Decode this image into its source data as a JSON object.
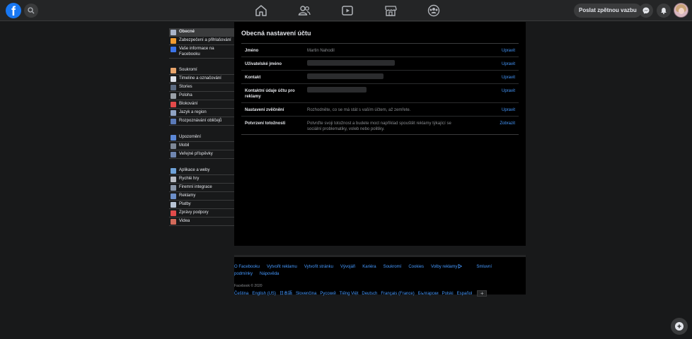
{
  "topbar": {
    "logo_letter": "f",
    "feedback_label": "Poslat zpětnou vazbu",
    "nav_icons": [
      "home-icon",
      "friends-icon",
      "watch-icon",
      "marketplace-icon",
      "groups-icon"
    ]
  },
  "settings_nav": {
    "groups": [
      {
        "items": [
          {
            "label": "Obecné",
            "icon": "gear-icon",
            "color": "#aab4c8",
            "active": true
          },
          {
            "label": "Zabezpečení a přihlašování",
            "icon": "shield-icon",
            "color": "#f29b2f"
          },
          {
            "label": "Vaše informace na Facebooku",
            "icon": "facebook-icon",
            "color": "#3b73e8"
          }
        ]
      },
      {
        "items": [
          {
            "label": "Soukromí",
            "icon": "privacy-icon",
            "color": "#e8a46b"
          },
          {
            "label": "Timeline a označování",
            "icon": "timeline-icon",
            "color": "#dde1e8"
          },
          {
            "label": "Stories",
            "icon": "stories-icon",
            "color": "#5c6b82"
          },
          {
            "label": "Poloha",
            "icon": "location-icon",
            "color": "#9aa0a8"
          },
          {
            "label": "Blokování",
            "icon": "block-icon",
            "color": "#e34a4a"
          },
          {
            "label": "Jazyk a region",
            "icon": "language-icon",
            "color": "#8fa3c4"
          },
          {
            "label": "Rozpoznávání obličejů",
            "icon": "face-recognition-icon",
            "color": "#5a7ab8"
          }
        ]
      },
      {
        "items": [
          {
            "label": "Upozornění",
            "icon": "globe-icon",
            "color": "#5b87d6"
          },
          {
            "label": "Mobil",
            "icon": "mobile-icon",
            "color": "#7d8796"
          },
          {
            "label": "Veřejné příspěvky",
            "icon": "rss-icon",
            "color": "#6f86b0"
          }
        ]
      },
      {
        "items": [
          {
            "label": "Aplikace a weby",
            "icon": "apps-icon",
            "color": "#6fa2d8"
          },
          {
            "label": "Rychlé hry",
            "icon": "gamepad-icon",
            "color": "#b9bcc2"
          },
          {
            "label": "Firemní integrace",
            "icon": "business-icon",
            "color": "#8a96a8"
          },
          {
            "label": "Reklamy",
            "icon": "ads-icon",
            "color": "#6c8fc9"
          },
          {
            "label": "Platby",
            "icon": "payments-icon",
            "color": "#b8c4d4"
          },
          {
            "label": "Zprávy podpory",
            "icon": "support-icon",
            "color": "#e24b4b"
          },
          {
            "label": "Videa",
            "icon": "video-icon",
            "color": "#d26a5a"
          }
        ]
      }
    ]
  },
  "main": {
    "title": "Obecná nastavení účtu",
    "rows": [
      {
        "label": "Jméno",
        "value": "Martin Nahodil",
        "action": "Upravit"
      },
      {
        "label": "Uživatelské jméno",
        "value": "",
        "action": "Upravit"
      },
      {
        "label": "Kontakt",
        "value": "",
        "action": "Upravit"
      },
      {
        "label": "Kontaktní údaje účtu pro reklamy",
        "value": "",
        "action": "Upravit"
      },
      {
        "label": "Nastavení zvěčnění",
        "value": "Rozhodněte, co se má stát s vaším účtem, až zemřete.",
        "action": "Upravit"
      },
      {
        "label": "Potvrzení totožnosti",
        "value": "Potvrďte svoji totožnost a budete moct například spouštět reklamy týkající se sociální problematiky, voleb nebo politiky.",
        "action": "Zobrazit"
      }
    ]
  },
  "footer": {
    "links": [
      "O Facebooku",
      "Vytvořit reklamu",
      "Vytvořit stránku",
      "Vývojáři",
      "Kariéra",
      "Soukromí",
      "Cookies",
      "Volby reklamy",
      "Smluvní podmínky",
      "Nápověda"
    ],
    "copyright": "Facebook © 2020",
    "languages": [
      "Čeština",
      "English (US)",
      "日本語",
      "Slovenčina",
      "Русский",
      "Tiếng Việt",
      "Deutsch",
      "Français (France)",
      "Български",
      "Polski",
      "Español"
    ],
    "add_language": "+"
  }
}
